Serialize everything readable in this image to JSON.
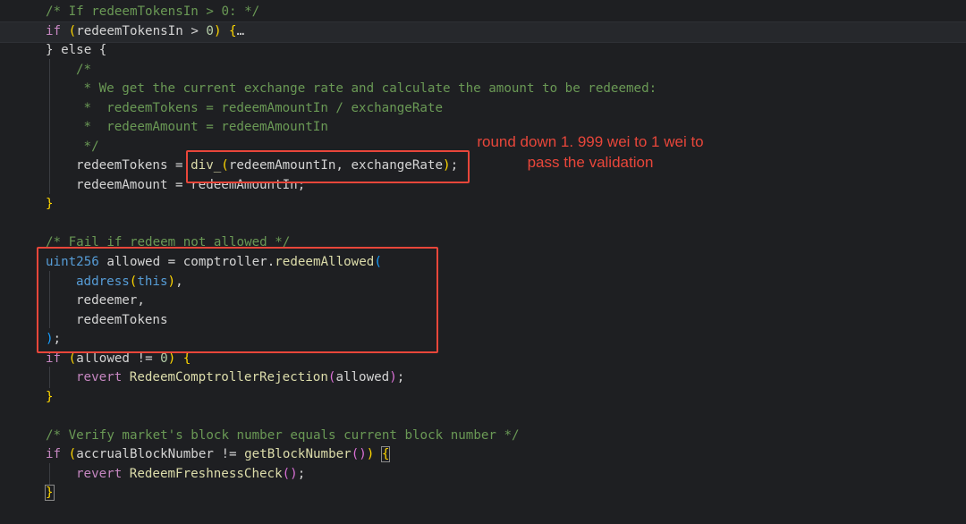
{
  "code": {
    "l1_comment": "/* If redeemTokensIn > 0: */",
    "l2_if": "if",
    "l2_var": "redeemTokensIn",
    "l2_op": " > ",
    "l2_num": "0",
    "l2_fold": "…",
    "l3": "} else {",
    "l4": "/*",
    "l5": " * We get the current exchange rate and calculate the amount to be redeemed:",
    "l6": " *  redeemTokens = redeemAmountIn / exchangeRate",
    "l7": " *  redeemAmount = redeemAmountIn",
    "l8": " */",
    "l9_lhs": "redeemTokens = ",
    "l9_fn": "div_",
    "l9_args": "redeemAmountIn, exchangeRate",
    "l10": "redeemAmount = redeemAmountIn;",
    "l11": "}",
    "l13": "/* Fail if redeem not allowed */",
    "l14_type": "uint256",
    "l14_rest": " allowed = comptroller.",
    "l14_fn": "redeemAllowed",
    "l15_fn": "address",
    "l15_this": "this",
    "l16": "redeemer,",
    "l17": "redeemTokens",
    "l18": ");",
    "l19_if": "if",
    "l19_var": "allowed",
    "l19_op": " != ",
    "l19_num": "0",
    "l20_kw": "revert",
    "l20_fn": "RedeemComptrollerRejection",
    "l20_arg": "allowed",
    "l21": "}",
    "l23": "/* Verify market's block number equals current block number */",
    "l24_if": "if",
    "l24_var": "accrualBlockNumber",
    "l24_op": " != ",
    "l24_fn": "getBlockNumber",
    "l25_kw": "revert",
    "l25_fn": "RedeemFreshnessCheck",
    "l26": "}"
  },
  "annotation": {
    "text": "round down 1. 999 wei to 1 wei to pass the validation",
    "line1": "round down 1. 999 wei to 1 wei to",
    "line2": "pass the validation",
    "color": "#e8463a"
  }
}
